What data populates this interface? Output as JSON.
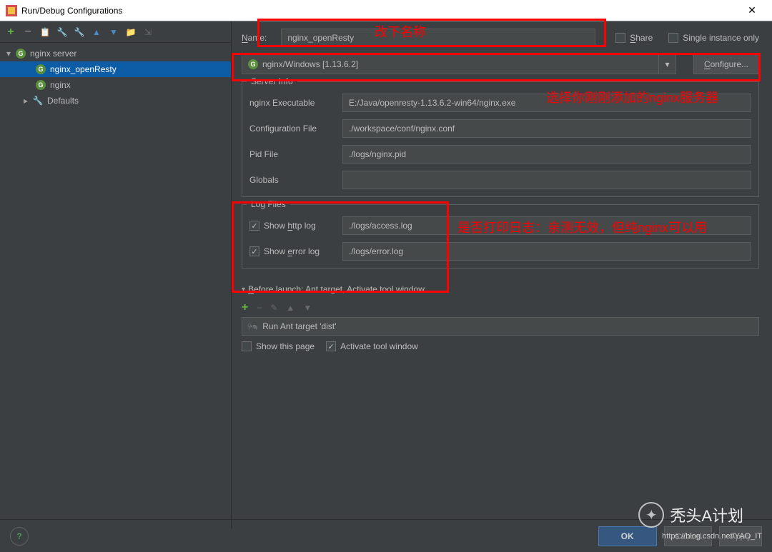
{
  "window": {
    "title": "Run/Debug Configurations"
  },
  "tree": {
    "root_name": "nginx server",
    "items": [
      {
        "label": "nginx_openResty",
        "selected": true
      },
      {
        "label": "nginx",
        "selected": false
      }
    ],
    "defaults_label": "Defaults"
  },
  "name": {
    "label": "Name:",
    "value": "nginx_openResty"
  },
  "share": {
    "label": "Share"
  },
  "single_instance": {
    "label": "Single instance only"
  },
  "server_dropdown": {
    "label": "nginx/Windows [1.13.6.2]"
  },
  "configure_btn": "Configure...",
  "server_info": {
    "legend": "Server Info",
    "nginx_exec_label": "nginx Executable",
    "nginx_exec_value": "E:/Java/openresty-1.13.6.2-win64/nginx.exe",
    "conf_label": "Configuration File",
    "conf_value": "./workspace/conf/nginx.conf",
    "pid_label": "Pid File",
    "pid_value": "./logs/nginx.pid",
    "globals_label": "Globals",
    "globals_value": ""
  },
  "log_files": {
    "legend": "Log Files",
    "http_label": "Show http log",
    "http_value": "./logs/access.log",
    "error_label": "Show error log",
    "error_value": "./logs/error.log"
  },
  "before_launch": {
    "title": "Before launch: Ant target, Activate tool window",
    "item": "Run Ant target 'dist'",
    "show_this_page": "Show this page",
    "activate_tool": "Activate tool window"
  },
  "footer": {
    "ok": "OK",
    "cancel": "Cancel",
    "apply": "Apply"
  },
  "annotations": {
    "a1": "改下名称",
    "a2": "选择你刚刚添加的nginx服务器",
    "a3": "是否打印日志：亲测无效，但纯nginx可以用"
  },
  "watermark": {
    "text": "秃头A计划",
    "sub": "https://blog.csdn.net/YAO_IT"
  }
}
